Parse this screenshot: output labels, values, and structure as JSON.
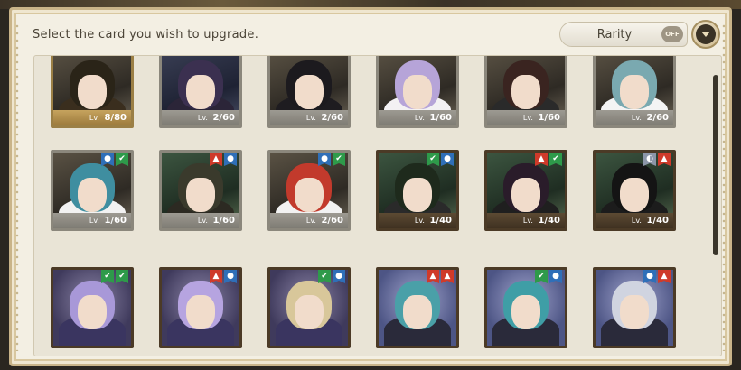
{
  "header": {
    "instruction": "Select the card you wish to upgrade.",
    "rarity_label": "Rarity",
    "rarity_toggle": "OFF"
  },
  "cards": [
    {
      "level": "8/80",
      "frame": "gold",
      "badges": [],
      "hair": "#2a2418",
      "bg": "bg-a",
      "outfit": "#3a2e1e"
    },
    {
      "level": "2/60",
      "frame": "gray",
      "badges": [],
      "hair": "#3b3050",
      "bg": "bg-c",
      "outfit": "#2b2538"
    },
    {
      "level": "2/60",
      "frame": "gray",
      "badges": [],
      "hair": "#1c1a1e",
      "bg": "bg-a",
      "outfit": "#1e1c20"
    },
    {
      "level": "1/60",
      "frame": "gray",
      "badges": [],
      "hair": "#b6a4d8",
      "bg": "bg-a",
      "outfit": "#f3f1f3"
    },
    {
      "level": "1/60",
      "frame": "gray",
      "badges": [],
      "hair": "#3a2420",
      "bg": "bg-a",
      "outfit": "#2a2a2a"
    },
    {
      "level": "2/60",
      "frame": "gray",
      "badges": [],
      "hair": "#7aa9b0",
      "bg": "bg-a",
      "outfit": "#f4f4f4"
    },
    {
      "level": "1/60",
      "frame": "gray",
      "badges": [
        "blue",
        "green"
      ],
      "hair": "#3f8ea0",
      "bg": "bg-a",
      "outfit": "#f2f2f2"
    },
    {
      "level": "1/60",
      "frame": "gray",
      "badges": [
        "red",
        "blue"
      ],
      "hair": "#3a3a2c",
      "bg": "bg-b",
      "outfit": "#2c2a22"
    },
    {
      "level": "2/60",
      "frame": "gray",
      "badges": [
        "blue",
        "green"
      ],
      "hair": "#c23a2c",
      "bg": "bg-a",
      "outfit": "#f2f2f2"
    },
    {
      "level": "1/40",
      "frame": "brown",
      "badges": [
        "green",
        "blue"
      ],
      "hair": "#1e2a1c",
      "bg": "bg-b",
      "outfit": "#2a2a2a"
    },
    {
      "level": "1/40",
      "frame": "brown",
      "badges": [
        "red",
        "green"
      ],
      "hair": "#2a1c2a",
      "bg": "bg-b",
      "outfit": "#1f1f1f"
    },
    {
      "level": "1/40",
      "frame": "brown",
      "badges": [
        "gray",
        "red"
      ],
      "hair": "#141414",
      "bg": "bg-b",
      "outfit": "#1c1c1c"
    },
    {
      "level": "",
      "frame": "brown",
      "badges": [
        "green",
        "green"
      ],
      "hair": "#a898d8",
      "bg": "bg-d",
      "outfit": "#3a3560"
    },
    {
      "level": "",
      "frame": "brown",
      "badges": [
        "red",
        "blue"
      ],
      "hair": "#b6a4e0",
      "bg": "bg-d",
      "outfit": "#3a3560"
    },
    {
      "level": "",
      "frame": "brown",
      "badges": [
        "green",
        "blue"
      ],
      "hair": "#d8c79a",
      "bg": "bg-d",
      "outfit": "#3a3560"
    },
    {
      "level": "",
      "frame": "brown",
      "badges": [
        "red",
        "red"
      ],
      "hair": "#4aa0a8",
      "bg": "bg-e",
      "outfit": "#2a2a3a"
    },
    {
      "level": "",
      "frame": "brown",
      "badges": [
        "green",
        "blue"
      ],
      "hair": "#3f9ea6",
      "bg": "bg-e",
      "outfit": "#2a2a3a"
    },
    {
      "level": "",
      "frame": "brown",
      "badges": [
        "blue",
        "red"
      ],
      "hair": "#d0d4e0",
      "bg": "bg-e",
      "outfit": "#2a2a3a"
    }
  ],
  "labels": {
    "level_prefix": "Lv."
  },
  "colors": {
    "panel": "#f3efe3",
    "frame_gold": "#9b7f45",
    "frame_gray": "#8b877c",
    "frame_brown": "#4b3a26"
  },
  "icons": {
    "blue": "droplet-icon",
    "green": "leaf-icon",
    "red": "flame-icon",
    "gray": "moon-icon"
  }
}
